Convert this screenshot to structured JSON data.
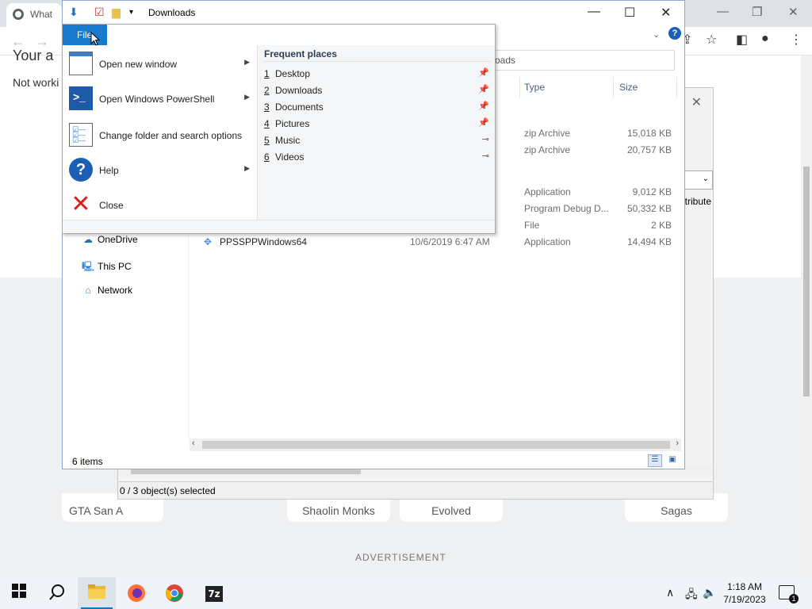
{
  "browser": {
    "tab_title": "What",
    "page_heading": "Your a",
    "page_text": "Not worki",
    "cards": [
      "GTA San A",
      "Shaolin Monks",
      "Evolved",
      "Sagas"
    ],
    "advertisement": "ADVERTISEMENT"
  },
  "dialog": {
    "attribute_header": "ttribute",
    "status_text": "0 / 3 object(s) selected"
  },
  "explorer": {
    "title": "Downloads",
    "address_text": "oads",
    "columns": {
      "type": "Type",
      "size": "Size"
    },
    "rows": [
      {
        "name": "",
        "date": "",
        "type": "zip Archive",
        "size": "15,018 KB"
      },
      {
        "name": "",
        "date": "",
        "type": "zip Archive",
        "size": "20,757 KB"
      },
      {
        "name": "",
        "date": "",
        "type": "Application",
        "size": "9,012 KB"
      },
      {
        "name": "",
        "date": "",
        "type": "Program Debug D...",
        "size": "50,332 KB"
      },
      {
        "name": "",
        "date": "",
        "type": "File",
        "size": "2 KB"
      },
      {
        "name": "PPSSPPWindows64",
        "date": "10/6/2019 6:47 AM",
        "type": "Application",
        "size": "14,494 KB"
      }
    ],
    "nav": [
      "OneDrive",
      "This PC",
      "Network"
    ],
    "item_count": "6 items"
  },
  "file_menu": {
    "tab_label": "File",
    "items": [
      {
        "label": "Open new window"
      },
      {
        "label": "Open Windows PowerShell"
      },
      {
        "label": "Change folder and search options"
      },
      {
        "label": "Help"
      },
      {
        "label": "Close"
      }
    ],
    "frequent_header": "Frequent places",
    "frequent": [
      {
        "num": "1",
        "name": "Desktop"
      },
      {
        "num": "2",
        "name": "Downloads"
      },
      {
        "num": "3",
        "name": "Documents"
      },
      {
        "num": "4",
        "name": "Pictures"
      },
      {
        "num": "5",
        "name": "Music"
      },
      {
        "num": "6",
        "name": "Videos"
      }
    ]
  },
  "taskbar": {
    "time": "1:18 AM",
    "date": "7/19/2023",
    "notification_count": "1",
    "app_7z": "7z"
  },
  "colors": {
    "accent": "#1979ca",
    "taskbar": "#f0f3f7"
  }
}
